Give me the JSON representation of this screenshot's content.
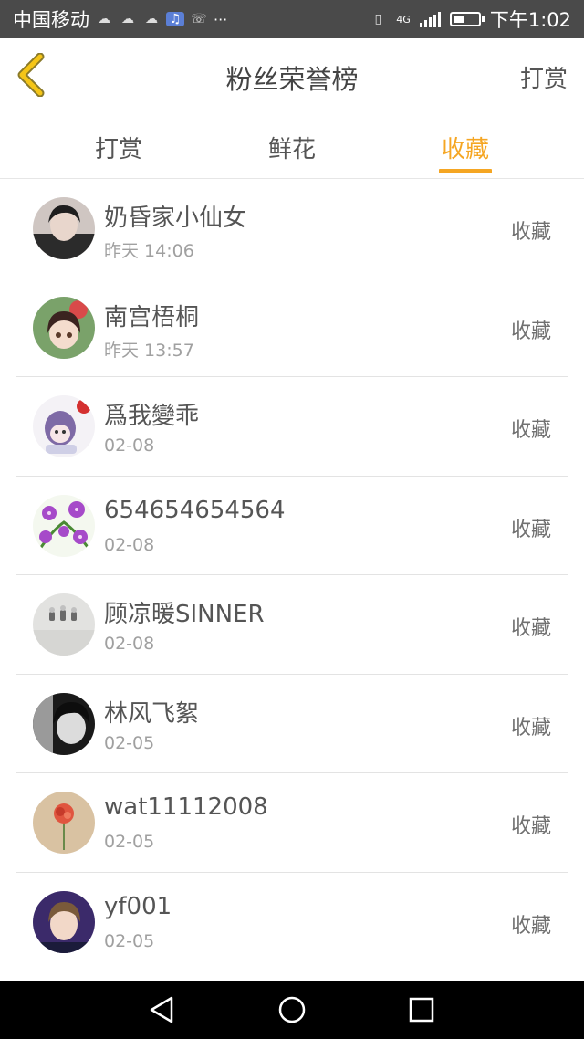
{
  "status_bar": {
    "carrier": "中国移动",
    "notification_icons": [
      "weather-icon",
      "weather-icon",
      "weather-icon",
      "music-icon",
      "missed-call-icon"
    ],
    "more": "···",
    "network": "4G",
    "time": "下午1:02",
    "battery_level": 0.45
  },
  "header": {
    "title": "粉丝荣誉榜",
    "action_label": "打赏"
  },
  "tabs": [
    {
      "label": "打赏",
      "active": false
    },
    {
      "label": "鲜花",
      "active": false
    },
    {
      "label": "收藏",
      "active": true
    }
  ],
  "fans": [
    {
      "name": "奶昏家小仙女",
      "time": "昨天 14:06",
      "type": "收藏"
    },
    {
      "name": "南宫梧桐",
      "time": "昨天 13:57",
      "type": "收藏"
    },
    {
      "name": "爲我變乖",
      "time": "02-08",
      "type": "收藏"
    },
    {
      "name": "654654654564",
      "time": "02-08",
      "type": "收藏"
    },
    {
      "name": "顾凉暖SINNER",
      "time": "02-08",
      "type": "收藏"
    },
    {
      "name": "林风飞絮",
      "time": "02-05",
      "type": "收藏"
    },
    {
      "name": "wat11112008",
      "time": "02-05",
      "type": "收藏"
    },
    {
      "name": "yf001",
      "time": "02-05",
      "type": "收藏"
    }
  ],
  "colors": {
    "accent": "#f5a623",
    "status_bar_bg": "#4a4a4a",
    "nav_bar_bg": "#000000",
    "text_primary": "#555555",
    "text_secondary": "#a0a0a0"
  },
  "icons": {
    "back": "chevron-left-icon",
    "system_back": "triangle-back-icon",
    "system_home": "circle-home-icon",
    "system_recents": "square-recents-icon"
  }
}
